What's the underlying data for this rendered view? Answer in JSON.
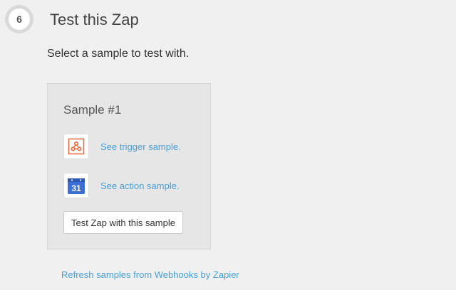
{
  "step": {
    "number": "6",
    "title": "Test this Zap"
  },
  "instruction": "Select a sample to test with.",
  "sample": {
    "title": "Sample #1",
    "trigger": {
      "icon": "webhooks-icon",
      "link": "See trigger sample.",
      "icon_color": "#e8673b"
    },
    "action": {
      "icon": "google-calendar-icon",
      "icon_text": "31",
      "link": "See action sample.",
      "icon_color": "#3b6fd6"
    },
    "test_button": "Test Zap with this sample"
  },
  "refresh_link": "Refresh samples from Webhooks by Zapier",
  "colors": {
    "background": "#f0f0f0",
    "link": "#4a9fd8",
    "card": "#e6e6e6"
  }
}
